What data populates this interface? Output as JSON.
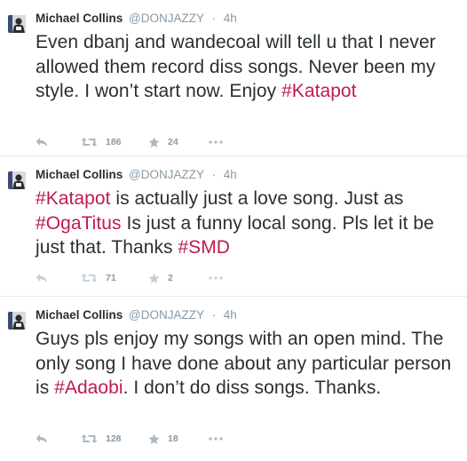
{
  "colors": {
    "hashtag": "#be1c4b",
    "text": "#292f33",
    "muted": "#8899a6",
    "icon": "#aab8c2",
    "divider": "#e1e8ed"
  },
  "tweets": [
    {
      "author": {
        "name": "Michael Collins",
        "handle": "@DONJAZZY"
      },
      "separator": "·",
      "time": "4h",
      "segments": [
        {
          "t": "Even dbanj and wandecoal will tell u that I never allowed them record diss songs. Never been my style. I won’t start now. Enjoy ",
          "h": false
        },
        {
          "t": "#Katapot",
          "h": true
        }
      ],
      "retweets": "186",
      "favorites": "24",
      "icons": [
        "reply-icon",
        "retweet-icon",
        "favorite-star-icon",
        "more-dots-icon"
      ]
    },
    {
      "author": {
        "name": "Michael Collins",
        "handle": "@DONJAZZY"
      },
      "separator": "·",
      "time": "4h",
      "segments": [
        {
          "t": "#Katapot",
          "h": true
        },
        {
          "t": " is actually just a love song. Just as ",
          "h": false
        },
        {
          "t": "#OgaTitus",
          "h": true
        },
        {
          "t": " Is just a funny local song. Pls let it be just that. Thanks ",
          "h": false
        },
        {
          "t": "#SMD",
          "h": true
        }
      ],
      "retweets": "71",
      "favorites": "2",
      "icons": [
        "reply-icon",
        "retweet-icon",
        "favorite-star-icon",
        "more-dots-icon"
      ]
    },
    {
      "author": {
        "name": "Michael Collins",
        "handle": "@DONJAZZY"
      },
      "separator": "·",
      "time": "4h",
      "segments": [
        {
          "t": "Guys pls enjoy my songs with an open mind. The only song I have done about any particular person is ",
          "h": false
        },
        {
          "t": "#Adaobi",
          "h": true
        },
        {
          "t": ". I don’t do diss songs. Thanks.",
          "h": false
        }
      ],
      "retweets": "128",
      "favorites": "18",
      "icons": [
        "reply-icon",
        "retweet-icon",
        "favorite-star-icon",
        "more-dots-icon"
      ]
    }
  ]
}
